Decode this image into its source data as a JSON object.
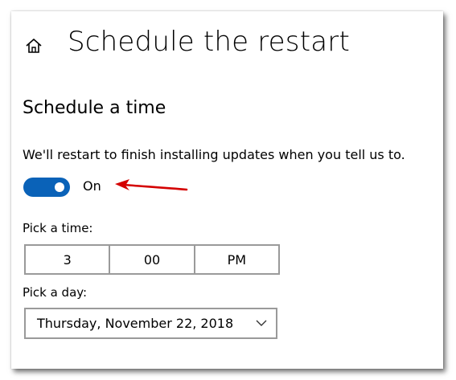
{
  "header": {
    "title": "Schedule the restart",
    "home_icon": "home-icon"
  },
  "section": {
    "title": "Schedule a time",
    "description": "We'll restart to finish installing updates when you tell us to."
  },
  "toggle": {
    "state_label": "On",
    "is_on": true,
    "color": "#0a62b8"
  },
  "annotation": {
    "arrow_color": "#d40000"
  },
  "time_picker": {
    "label": "Pick a time:",
    "hour": "3",
    "minute": "00",
    "period": "PM"
  },
  "day_picker": {
    "label": "Pick a day:",
    "value": "Thursday, November 22, 2018",
    "chevron_icon": "chevron-down-icon"
  }
}
